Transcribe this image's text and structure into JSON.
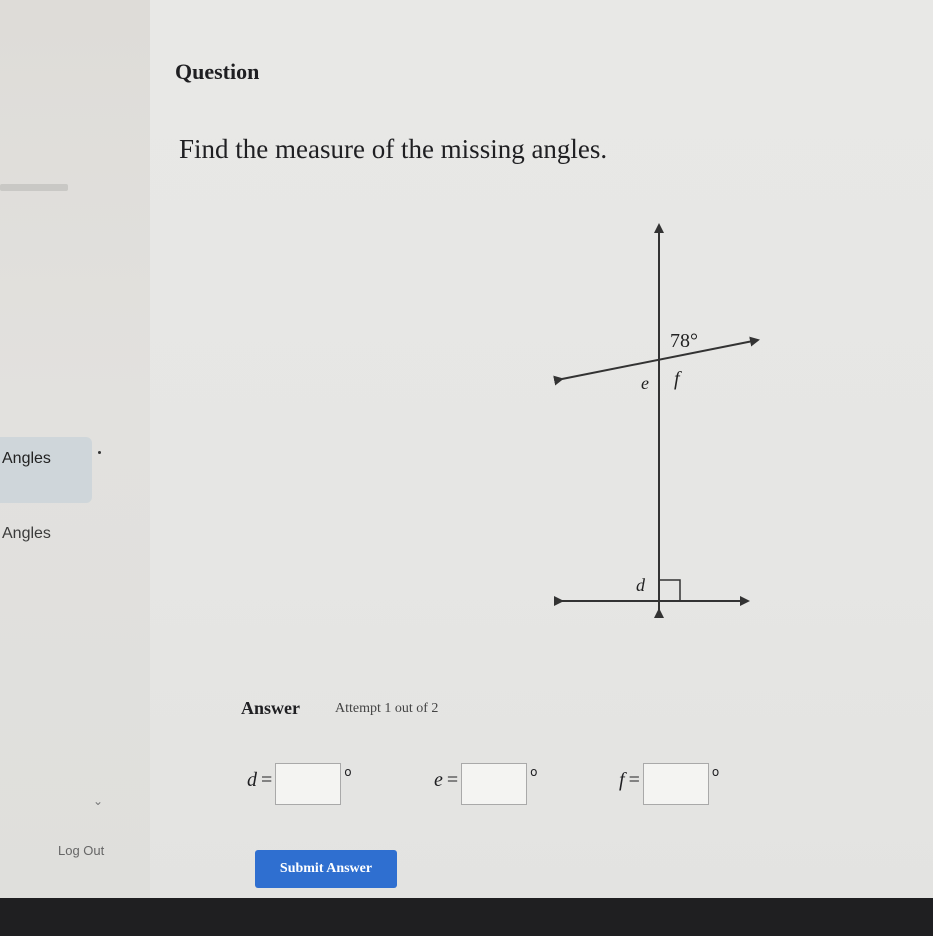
{
  "sidebar": {
    "items": [
      {
        "label": "Angles"
      },
      {
        "label": "Angles"
      }
    ],
    "logout_label": "Log Out",
    "chevron_icon": "chevron-down-icon"
  },
  "question": {
    "title": "Question",
    "text": "Find the measure of the missing angles."
  },
  "diagram": {
    "given_angle": "78°",
    "labels": {
      "e": "e",
      "f": "f",
      "d": "d"
    }
  },
  "answer": {
    "label": "Answer",
    "attempt": "Attempt 1 out of 2",
    "fields": [
      {
        "var": "d",
        "eq": "=",
        "value": "",
        "unit": "o"
      },
      {
        "var": "e",
        "eq": "=",
        "value": "",
        "unit": "o"
      },
      {
        "var": "f",
        "eq": "=",
        "value": "",
        "unit": "o"
      }
    ]
  },
  "submit_label": "Submit Answer",
  "colors": {
    "accent": "#2f6fd0",
    "bezel": "#1f1f21",
    "active_item": "#cfd6da"
  }
}
